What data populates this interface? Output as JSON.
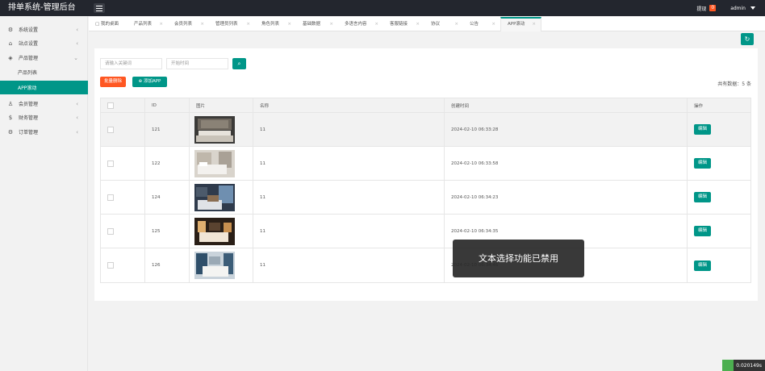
{
  "app": {
    "title": "排单系统-管理后台"
  },
  "topbar": {
    "withdraw_label": "提现",
    "withdraw_count": "0",
    "user": "admin"
  },
  "sidebar": {
    "items": [
      {
        "label": "系统设置",
        "icon": "gear-icon"
      },
      {
        "label": "站点设置",
        "icon": "home-icon"
      },
      {
        "label": "产品管理",
        "icon": "box-icon"
      },
      {
        "label": "产品列表",
        "icon": ""
      },
      {
        "label": "APP滚动",
        "icon": ""
      },
      {
        "label": "会员管理",
        "icon": "user-icon"
      },
      {
        "label": "财务管理",
        "icon": "dollar-icon"
      },
      {
        "label": "订单管理",
        "icon": "gear-icon"
      }
    ]
  },
  "tabs": [
    {
      "label": "我的桌面"
    },
    {
      "label": "产品列表"
    },
    {
      "label": "会员列表"
    },
    {
      "label": "管理员列表"
    },
    {
      "label": "角色列表"
    },
    {
      "label": "基础数据"
    },
    {
      "label": "多语言内容"
    },
    {
      "label": "客服链接"
    },
    {
      "label": "协议"
    },
    {
      "label": "公告"
    },
    {
      "label": "APP滚动"
    }
  ],
  "search": {
    "keyword_placeholder": "请输入关键词",
    "date_placeholder": "开始时间"
  },
  "actions": {
    "batch_delete": "批量删除",
    "add_app": "添加APP"
  },
  "summary": {
    "total": "共有数据：5 条"
  },
  "table": {
    "headers": [
      "ID",
      "图片",
      "名称",
      "创建时间",
      "操作"
    ],
    "rows": [
      {
        "id": "121",
        "name": "11",
        "created": "2024-02-10 06:33:28",
        "action": "编辑"
      },
      {
        "id": "122",
        "name": "11",
        "created": "2024-02-10 06:33:58",
        "action": "编辑"
      },
      {
        "id": "124",
        "name": "11",
        "created": "2024-02-10 06:34:23",
        "action": "编辑"
      },
      {
        "id": "125",
        "name": "11",
        "created": "2024-02-10 06:34:35",
        "action": "编辑"
      },
      {
        "id": "126",
        "name": "11",
        "created": "2024-02-10 06:34:46",
        "action": "编辑"
      }
    ]
  },
  "toast": {
    "message": "文本选择功能已禁用"
  },
  "timer": {
    "value": "0.020149s"
  },
  "colors": {
    "primary": "#009688",
    "danger": "#ff5722",
    "topbar": "#23262e"
  }
}
